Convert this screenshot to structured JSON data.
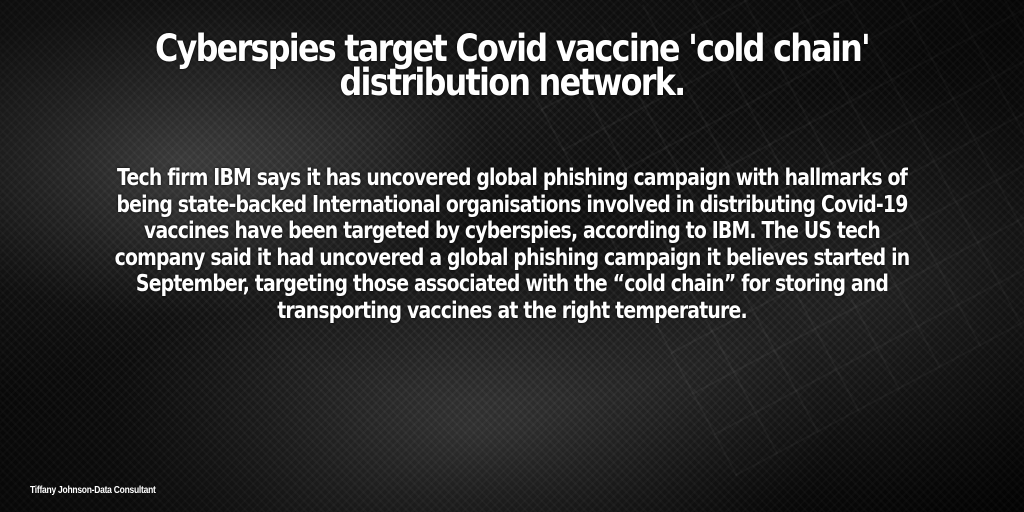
{
  "post": {
    "headline": "Cyberspies target Covid vaccine 'cold chain' distribution network.",
    "body": "Tech firm IBM says it has uncovered global phishing campaign with hallmarks of being state-backed International organisations involved in distributing Covid-19 vaccines have been targeted by cyberspies, according to IBM. The US tech company said it had uncovered a global phishing campaign it believes started in September, targeting those associated with the “cold chain” for storing and transporting vaccines at the right temperature.",
    "credit": "Tiffany Johnson-Data Consultant"
  }
}
